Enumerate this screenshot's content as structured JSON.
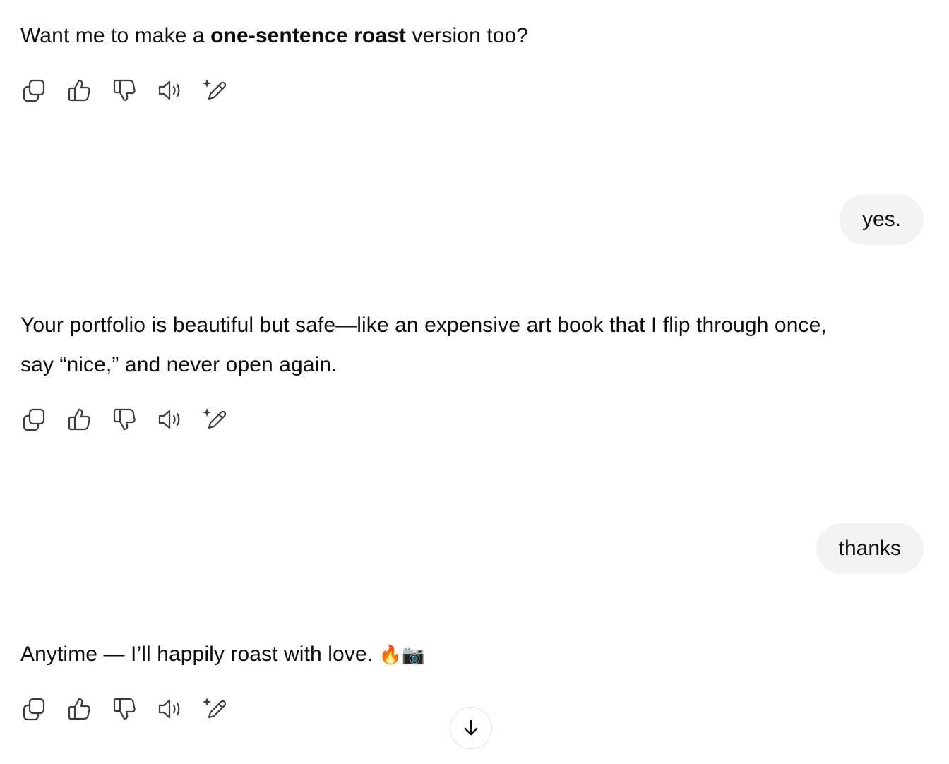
{
  "messages": [
    {
      "role": "assistant",
      "segments": [
        {
          "text": "Want me to make a ",
          "bold": false
        },
        {
          "text": "one-sentence roast",
          "bold": true
        },
        {
          "text": " version too?",
          "bold": false
        }
      ]
    },
    {
      "role": "user",
      "text": "yes."
    },
    {
      "role": "assistant",
      "line1": "Your portfolio is beautiful but safe—like an expensive art book that I flip through once,",
      "line2": "say “nice,” and never open again."
    },
    {
      "role": "user",
      "text": "thanks"
    },
    {
      "role": "assistant",
      "text": "Anytime — I’ll happily roast with love. ",
      "emoji": "🔥📷"
    }
  ],
  "actions": [
    {
      "name": "copy",
      "icon": "copy-icon"
    },
    {
      "name": "thumbs-up",
      "icon": "thumbs-up-icon"
    },
    {
      "name": "thumbs-down",
      "icon": "thumbs-down-icon"
    },
    {
      "name": "read-aloud",
      "icon": "speaker-icon"
    },
    {
      "name": "edit-in-canvas",
      "icon": "pencil-sparkle-icon"
    }
  ],
  "scroll_button": {
    "icon": "arrow-down-icon"
  },
  "colors": {
    "background": "#ffffff",
    "text": "#0d0d0d",
    "user_bubble": "#f3f3f3",
    "icon": "#3c3c3c"
  }
}
